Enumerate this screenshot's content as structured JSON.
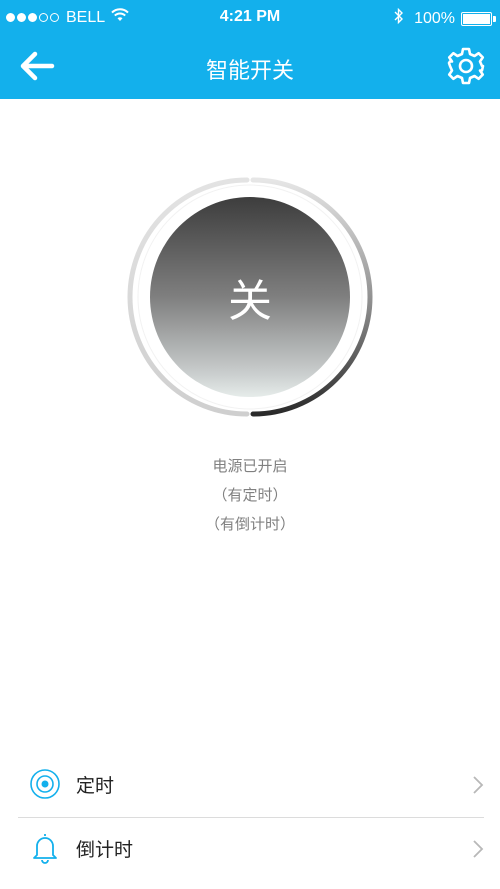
{
  "status_bar": {
    "carrier": "BELL",
    "time": "4:21 PM",
    "battery_percent": "100%"
  },
  "nav": {
    "title": "智能开关",
    "back_icon": "arrow-left-icon",
    "settings_icon": "gear-icon"
  },
  "power_button": {
    "label": "关"
  },
  "status": {
    "line1": "电源已开启",
    "line2": "（有定时）",
    "line3": "（有倒计时）"
  },
  "menu": {
    "items": [
      {
        "label": "定时",
        "icon": "target-icon"
      },
      {
        "label": "倒计时",
        "icon": "bell-icon"
      }
    ]
  },
  "colors": {
    "header": "#13b0ec",
    "accent": "#13b0ec",
    "text_gray": "#808080"
  }
}
